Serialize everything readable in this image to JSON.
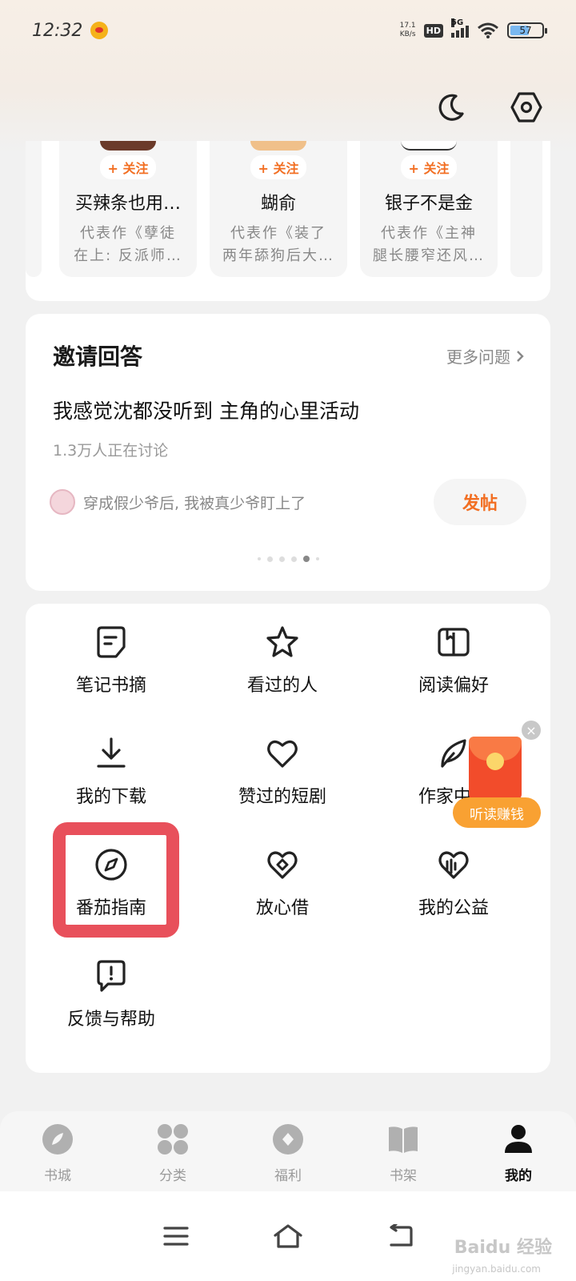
{
  "status_bar": {
    "time": "12:32",
    "net_speed_value": "17.1",
    "net_speed_unit": "KB/s",
    "hd": "HD",
    "network": "5G",
    "battery": "57"
  },
  "authors": [
    {
      "follow": "+ 关注",
      "name": "买辣条也用…",
      "work_line1": "代表作《孽徒",
      "work_line2": "在上: 反派师…"
    },
    {
      "follow": "+ 关注",
      "name": "蝴俞",
      "work_line1": "代表作《装了",
      "work_line2": "两年舔狗后大…"
    },
    {
      "follow": "+ 关注",
      "name": "银子不是金",
      "work_line1": "代表作《主神",
      "work_line2": "腿长腰窄还风…"
    }
  ],
  "invite": {
    "title": "邀请回答",
    "more": "更多问题",
    "question": "我感觉沈都没听到 主角的心里活动",
    "discussion": "1.3万人正在讨论",
    "post_text": "穿成假少爷后, 我被真少爷盯上了",
    "post_button": "发帖"
  },
  "tools": [
    {
      "label": "笔记书摘",
      "icon": "note-icon"
    },
    {
      "label": "看过的人",
      "icon": "star-icon"
    },
    {
      "label": "阅读偏好",
      "icon": "book-open-icon"
    },
    {
      "label": "我的下载",
      "icon": "download-icon"
    },
    {
      "label": "赞过的短剧",
      "icon": "heart-icon"
    },
    {
      "label": "作家中心",
      "icon": "feather-icon"
    },
    {
      "label": "番茄指南",
      "icon": "compass-icon"
    },
    {
      "label": "放心借",
      "icon": "coin-heart-icon"
    },
    {
      "label": "我的公益",
      "icon": "charity-heart-icon"
    },
    {
      "label": "反馈与帮助",
      "icon": "feedback-icon"
    }
  ],
  "reward": {
    "label": "听读赚钱",
    "close": "×"
  },
  "bottom_nav": [
    {
      "label": "书城",
      "icon": "bookstore-icon"
    },
    {
      "label": "分类",
      "icon": "category-icon"
    },
    {
      "label": "福利",
      "icon": "welfare-icon"
    },
    {
      "label": "书架",
      "icon": "bookshelf-icon"
    },
    {
      "label": "我的",
      "icon": "profile-icon",
      "active": true
    }
  ],
  "watermark": {
    "brand": "Baidu 经验",
    "url": "jingyan.baidu.com"
  },
  "colors": {
    "accent": "#f26f23",
    "highlight": "#e8505b",
    "reward": "#f9a132"
  }
}
